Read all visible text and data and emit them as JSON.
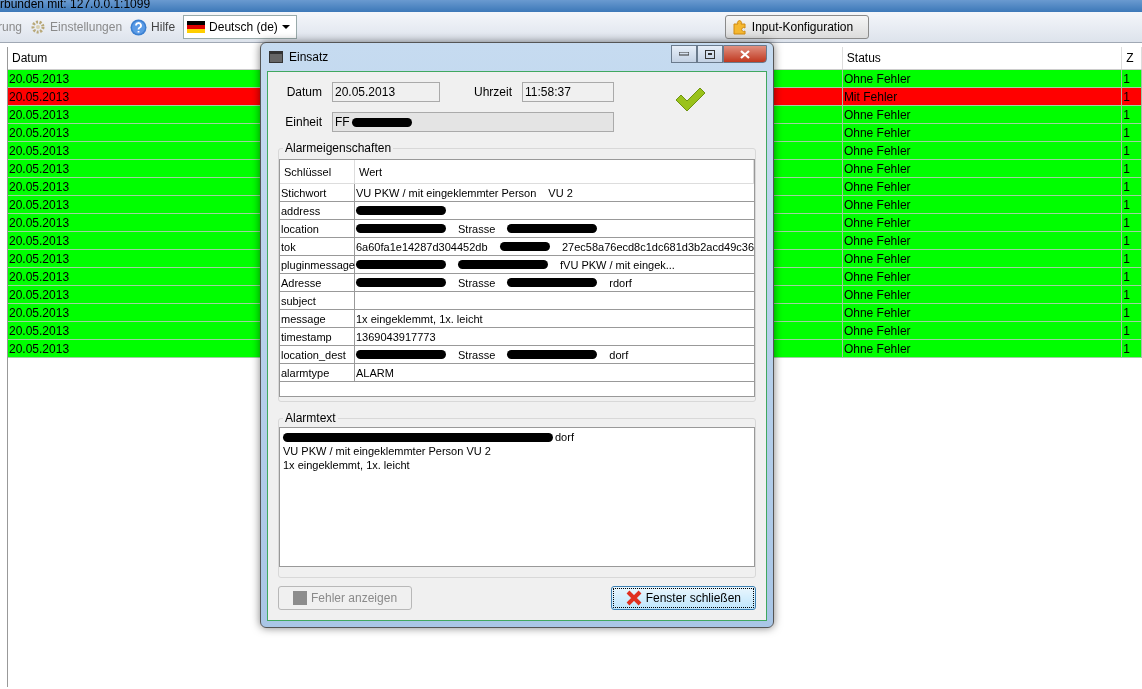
{
  "window": {
    "title": "rbunden mit: 127.0.0.1:1099"
  },
  "toolbar": {
    "items": [
      {
        "kind": "text",
        "label": "rung",
        "disabled": true
      },
      {
        "kind": "gear",
        "label": "Einstellungen",
        "disabled": true
      },
      {
        "kind": "help",
        "label": "Hilfe",
        "disabled": false
      }
    ],
    "language": "Deutsch (de)",
    "config_button": "Input-Konfiguration"
  },
  "table": {
    "columns": [
      "Datum",
      "Status",
      "Z"
    ],
    "rows": [
      {
        "kind": "ok",
        "date": "20.05.2013",
        "status": "Ohne Fehler",
        "column_3": "1"
      },
      {
        "kind": "error",
        "date": "20.05.2013",
        "status": "Mit Fehler",
        "column_3": "1"
      },
      {
        "kind": "ok",
        "date": "20.05.2013",
        "status": "Ohne Fehler",
        "column_3": "1"
      },
      {
        "kind": "ok",
        "date": "20.05.2013",
        "status": "Ohne Fehler",
        "column_3": "1"
      },
      {
        "kind": "ok",
        "date": "20.05.2013",
        "status": "Ohne Fehler",
        "column_3": "1"
      },
      {
        "kind": "ok",
        "date": "20.05.2013",
        "status": "Ohne Fehler",
        "column_3": "1"
      },
      {
        "kind": "ok",
        "date": "20.05.2013",
        "status": "Ohne Fehler",
        "column_3": "1"
      },
      {
        "kind": "ok",
        "date": "20.05.2013",
        "status": "Ohne Fehler",
        "column_3": "1"
      },
      {
        "kind": "ok",
        "date": "20.05.2013",
        "status": "Ohne Fehler",
        "column_3": "1"
      },
      {
        "kind": "ok",
        "date": "20.05.2013",
        "status": "Ohne Fehler",
        "column_3": "1"
      },
      {
        "kind": "ok",
        "date": "20.05.2013",
        "status": "Ohne Fehler",
        "column_3": "1"
      },
      {
        "kind": "ok",
        "date": "20.05.2013",
        "status": "Ohne Fehler",
        "column_3": "1"
      },
      {
        "kind": "ok",
        "date": "20.05.2013",
        "status": "Ohne Fehler",
        "column_3": "1"
      },
      {
        "kind": "ok",
        "date": "20.05.2013",
        "status": "Ohne Fehler",
        "column_3": "1"
      },
      {
        "kind": "ok",
        "date": "20.05.2013",
        "status": "Ohne Fehler",
        "column_3": "1"
      },
      {
        "kind": "ok",
        "date": "20.05.2013",
        "status": "Ohne Fehler",
        "column_3": "1"
      }
    ]
  },
  "dialog": {
    "title": "Einsatz",
    "date_label": "Datum",
    "date": "20.05.2013",
    "time_label": "Uhrzeit",
    "time": "11:58:37",
    "unit_label": "Einheit",
    "unit": "FF",
    "unit_redacted": true,
    "properties": {
      "title": "Alarmeigenschaften",
      "columns": [
        "Schlüssel",
        "Wert"
      ],
      "rows": [
        {
          "key": "Stichwort",
          "value": [
            {
              "kind": "text",
              "text": "VU PKW / mit eingeklemmter Person"
            },
            {
              "kind": "text",
              "text": "VU 2"
            }
          ]
        },
        {
          "key": "address",
          "value": [
            {
              "kind": "redacted"
            }
          ]
        },
        {
          "key": "location",
          "value": [
            {
              "kind": "redacted"
            },
            {
              "kind": "text",
              "text": "Strasse"
            },
            {
              "kind": "redacted"
            }
          ]
        },
        {
          "key": "tok",
          "value": [
            {
              "kind": "text",
              "text": "6a60fa1e14287d304452db"
            },
            {
              "kind": "redacted"
            },
            {
              "kind": "text",
              "text": "27ec58a76ecd8c1dc681d3b2acd49c36"
            }
          ]
        },
        {
          "key": "pluginmessage",
          "value": [
            {
              "kind": "redacted"
            },
            {
              "kind": "redacted"
            },
            {
              "kind": "text",
              "text": "fVU PKW / mit eingek..."
            }
          ]
        },
        {
          "key": "Adresse",
          "value": [
            {
              "kind": "redacted"
            },
            {
              "kind": "text",
              "text": "Strasse"
            },
            {
              "kind": "redacted"
            },
            {
              "kind": "text",
              "text": "rdorf"
            }
          ]
        },
        {
          "key": "subject",
          "value": []
        },
        {
          "key": "message",
          "value": [
            {
              "kind": "text",
              "text": "1x eingeklemmt, 1x. leicht"
            }
          ]
        },
        {
          "key": "timestamp",
          "value": [
            {
              "kind": "text",
              "text": "1369043917773"
            }
          ]
        },
        {
          "key": "location_dest",
          "value": [
            {
              "kind": "redacted"
            },
            {
              "kind": "text",
              "text": "Strasse"
            },
            {
              "kind": "redacted"
            },
            {
              "kind": "text",
              "text": "dorf"
            }
          ]
        },
        {
          "key": "alarmtype",
          "value": [
            {
              "kind": "text",
              "text": "ALARM"
            }
          ]
        }
      ]
    },
    "alarm_text": {
      "title": "Alarmtext",
      "lines": [
        [
          {
            "kind": "redacted"
          },
          {
            "kind": "text",
            "text": "dorf"
          }
        ],
        [
          {
            "kind": "text",
            "text": "VU PKW / mit eingeklemmter Person VU 2"
          }
        ],
        [
          {
            "kind": "text",
            "text": "1x eingeklemmt, 1x. leicht"
          }
        ]
      ]
    },
    "buttons": [
      {
        "kind": "errors",
        "label": "Fehler anzeigen",
        "disabled": true,
        "focused": false
      },
      {
        "kind": "close",
        "label": "Fenster schließen",
        "disabled": false,
        "focused": true
      }
    ]
  }
}
